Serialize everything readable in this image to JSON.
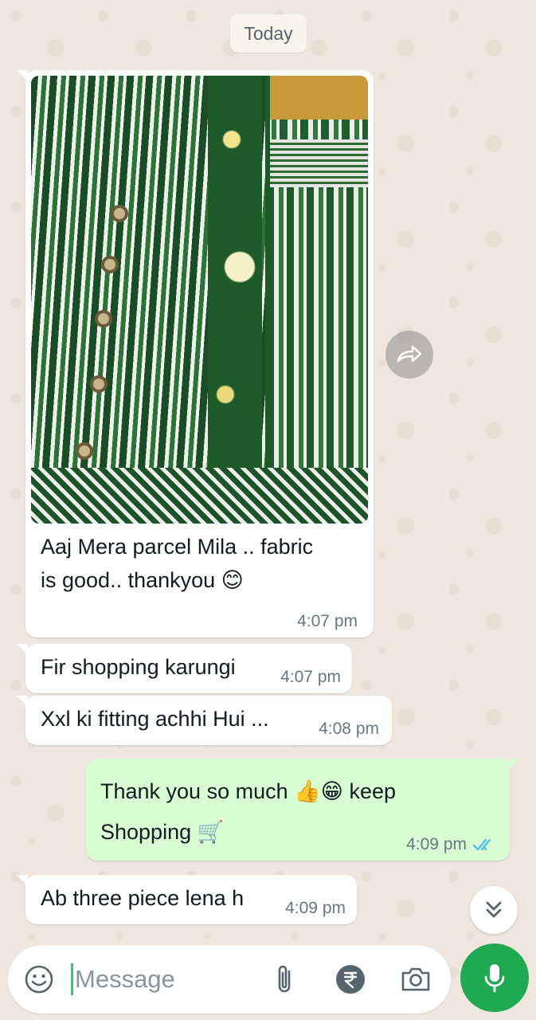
{
  "chat": {
    "date_label": "Today",
    "messages": [
      {
        "type": "in",
        "has_image": true,
        "text_line1": "Aaj Mera parcel Mila .. fabric",
        "text_line2": "is good.. thankyou",
        "emoji": "😊",
        "time": "4:07 pm"
      },
      {
        "type": "in",
        "text": "Fir shopping karungi",
        "time": "4:07 pm"
      },
      {
        "type": "in",
        "text": "Xxl ki fitting achhi Hui ...",
        "time": "4:08 pm"
      },
      {
        "type": "out",
        "text_line1": "Thank you so much",
        "emoji_a": "👍",
        "emoji_b": "😁",
        "text_line1_end": "keep",
        "text_line2": "Shopping",
        "emoji_c": "🛒",
        "time": "4:09 pm",
        "status": "read"
      },
      {
        "type": "in",
        "text": "Ab three piece lena h",
        "time": "4:09 pm"
      }
    ]
  },
  "composer": {
    "placeholder": "Message",
    "icons": [
      "emoji-icon",
      "attach-icon",
      "rupee-payment-icon",
      "camera-icon",
      "mic-icon"
    ]
  },
  "colors": {
    "accent_green": "#1ea952",
    "outgoing_bubble": "#d9fdd3",
    "read_ticks": "#53bdeb"
  }
}
